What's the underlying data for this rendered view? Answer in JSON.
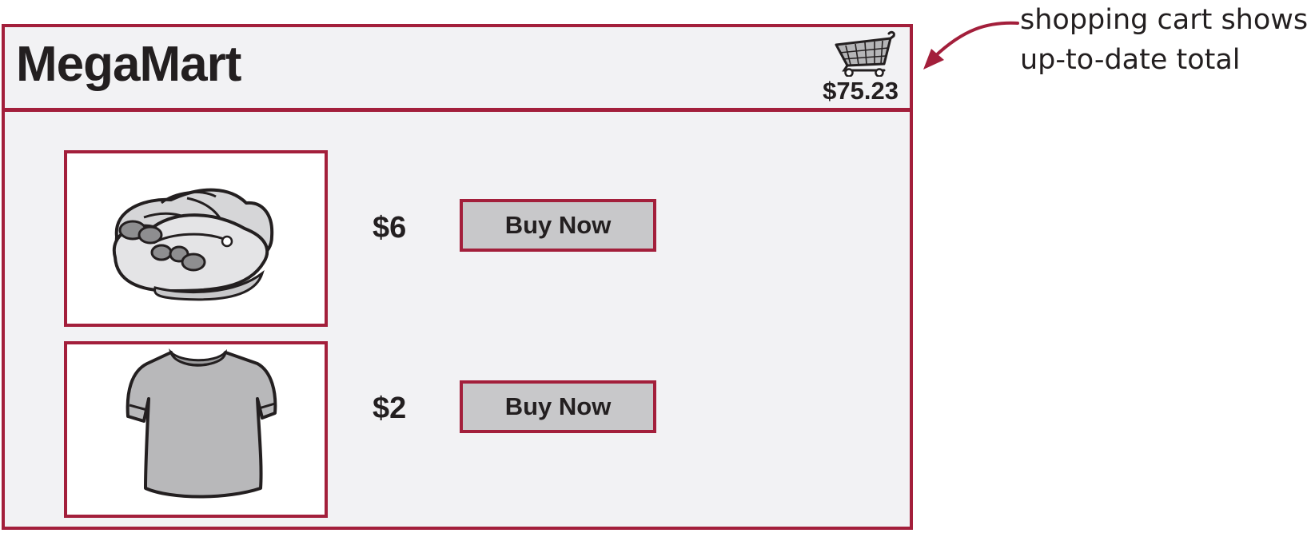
{
  "header": {
    "store_name": "MegaMart",
    "cart_total": "$75.23",
    "cart_icon": "shopping-cart-icon"
  },
  "products": [
    {
      "image_icon": "shoes-icon",
      "price": "$6",
      "button_label": "Buy Now"
    },
    {
      "image_icon": "tshirt-icon",
      "price": "$2",
      "button_label": "Buy Now"
    }
  ],
  "annotation": {
    "lines": [
      "shopping cart shows",
      "up-to-date total"
    ]
  },
  "colors": {
    "accent": "#a31f3b",
    "background": "#f2f2f4",
    "button": "#c8c8ca",
    "text": "#231f20"
  }
}
